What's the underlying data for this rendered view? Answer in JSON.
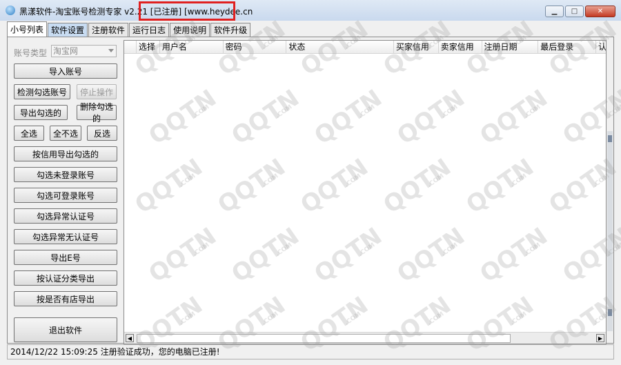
{
  "window": {
    "title": "黑漾软件-淘宝账号检测专家 v2.21",
    "registered_tag": "[已注册]",
    "website": "[www.heydee.cn",
    "minimize_label": "▁",
    "maximize_label": "□",
    "close_label": "✕"
  },
  "tabs": [
    {
      "label": "小号列表"
    },
    {
      "label": "软件设置"
    },
    {
      "label": "注册软件"
    },
    {
      "label": "运行日志"
    },
    {
      "label": "使用说明"
    },
    {
      "label": "软件升级"
    }
  ],
  "left_panel": {
    "account_type_label": "账号类型",
    "account_type_value": "淘宝网",
    "buttons": {
      "import": "导入账号",
      "check_selected": "检测勾选账号",
      "stop": "停止操作",
      "export_selected": "导出勾选的",
      "delete_selected": "删除勾选的",
      "select_all": "全选",
      "select_none": "全不选",
      "invert": "反选",
      "export_by_credit": "按信用导出勾选的",
      "select_not_login": "勾选未登录账号",
      "select_loginable": "勾选可登录账号",
      "select_abnormal_cert": "勾选异常认证号",
      "select_abnormal_no_cert": "勾选异常无认证号",
      "export_e": "导出E号",
      "export_by_cert": "按认证分类导出",
      "export_by_shop": "按是否有店导出",
      "exit": "退出软件"
    }
  },
  "grid": {
    "columns": [
      "选择",
      "用户名",
      "密码",
      "状态",
      "买家信用",
      "卖家信用",
      "注册日期",
      "最后登录",
      "认"
    ],
    "scroll_left_label": "◀",
    "scroll_right_label": "▶"
  },
  "status_bar": {
    "timestamp": "2014/12/22 15:09:25",
    "message": "注册验证成功，您的电脑已注册!"
  },
  "watermark": {
    "text": "QQTN",
    "suffix": ".COM"
  }
}
